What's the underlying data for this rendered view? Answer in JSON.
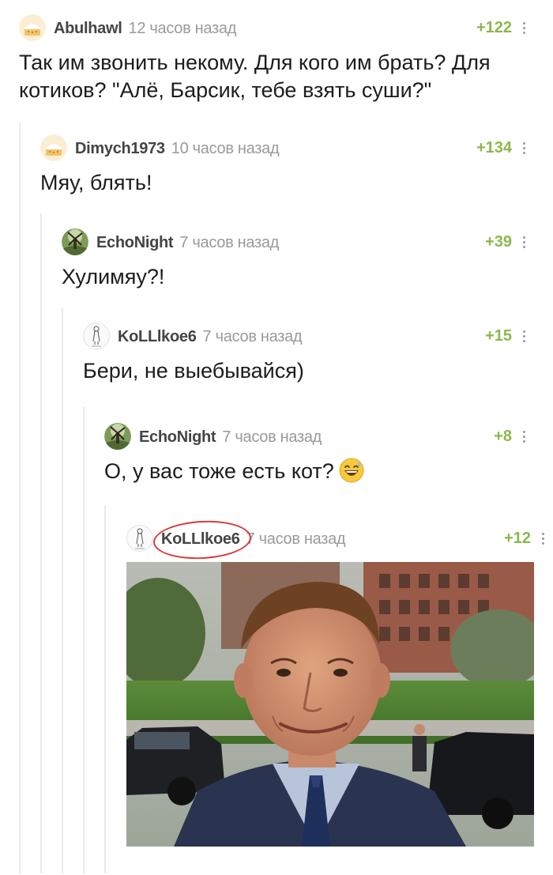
{
  "comments": [
    {
      "username": "Abulhawl",
      "time": "12 часов назад",
      "rating": "+122",
      "text": "Так им звонить некому. Для кого им брать? Для котиков? \"Алё, Барсик, тебе взять суши?\"",
      "avatar_icon": "cake-avatar-icon"
    },
    {
      "username": "Dimych1973",
      "time": "10 часов назад",
      "rating": "+134",
      "text": "Мяу, блять!",
      "avatar_icon": "cake-avatar-icon"
    },
    {
      "username": "EchoNight",
      "time": "7 часов назад",
      "rating": "+39",
      "text": "Хулимяу?!",
      "avatar_icon": "windmill-avatar-icon"
    },
    {
      "username": "KoLLlkoe6",
      "time": "7 часов назад",
      "rating": "+15",
      "text": "Бери, не выебывайся)",
      "avatar_icon": "sketch-avatar-icon"
    },
    {
      "username": "EchoNight",
      "time": "7 часов назад",
      "rating": "+8",
      "text": "О, у вас тоже есть кот?",
      "avatar_icon": "windmill-avatar-icon",
      "emoji": "grinning-sweat-emoji"
    },
    {
      "username": "KoLLlkoe6",
      "time": "7 часов назад",
      "rating": "+12",
      "text": "",
      "avatar_icon": "sketch-avatar-icon",
      "image": "smiling-man-photo"
    }
  ],
  "colors": {
    "rating": "#8cb84b",
    "username": "#444444",
    "timestamp": "#9a9a9a",
    "thread_line": "#e9e9e9",
    "circle_annotation": "#d63a3a"
  }
}
